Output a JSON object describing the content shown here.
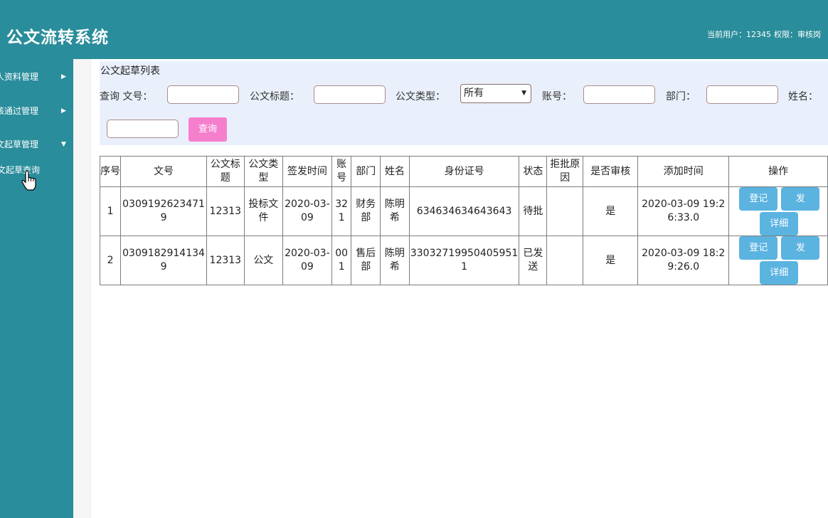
{
  "header": {
    "title": "公文流转系统",
    "user_label": "当前用户：12345",
    "role_label": "权限：审核岗"
  },
  "sidebar": {
    "items": [
      {
        "label": "人资料管理",
        "arrow": "▶"
      },
      {
        "label": "核通过管理",
        "arrow": "▶"
      },
      {
        "label": "文起草管理",
        "arrow": "▼"
      }
    ],
    "sub_item": "文起草查询"
  },
  "panel": {
    "title": "公文起草列表",
    "query_prefix": "查询",
    "fields": {
      "doc_no": "文号：",
      "doc_title": "公文标题：",
      "doc_type": "公文类型：",
      "doc_type_value": "所有",
      "account": "账号：",
      "dept": "部门：",
      "name": "姓名："
    },
    "query_button": "查询"
  },
  "table": {
    "headers": [
      "序号",
      "文号",
      "公文标题",
      "公文类型",
      "签发时间",
      "账号",
      "部门",
      "姓名",
      "身份证号",
      "状态",
      "拒批原因",
      "是否审核",
      "添加时间",
      "操作"
    ],
    "rows": [
      {
        "no": "1",
        "doc_no": "03091926234719",
        "title": "12313",
        "type": "投标文件",
        "date": "2020-03-09",
        "account": "321",
        "dept": "财务部",
        "name": "陈明希",
        "id_card": "634634634643643",
        "status": "待批",
        "reason": "",
        "reviewed": "是",
        "added": "2020-03-09 19:26:33.0",
        "btn_register": "登记",
        "btn_send": "发",
        "btn_detail": "详细"
      },
      {
        "no": "2",
        "doc_no": "03091829141349",
        "title": "12313",
        "type": "公文",
        "date": "2020-03-09",
        "account": "001",
        "dept": "售后部",
        "name": "陈明希",
        "id_card": "330327199504059511",
        "status": "已发送",
        "reason": "",
        "reviewed": "是",
        "added": "2020-03-09 18:29:26.0",
        "btn_register": "登记",
        "btn_send": "发",
        "btn_detail": "详细"
      }
    ]
  },
  "icons": {
    "side_arrow": "chevron-right-icon",
    "side_arrow_open": "chevron-down-icon",
    "select_caret": "caret-down-icon",
    "cursor": "hand-pointer-icon"
  },
  "colors": {
    "topbar": "#2a8d9b",
    "panel": "#eaf0fb",
    "query_button": "#f57fcd",
    "action_button": "#5bb3e0"
  }
}
